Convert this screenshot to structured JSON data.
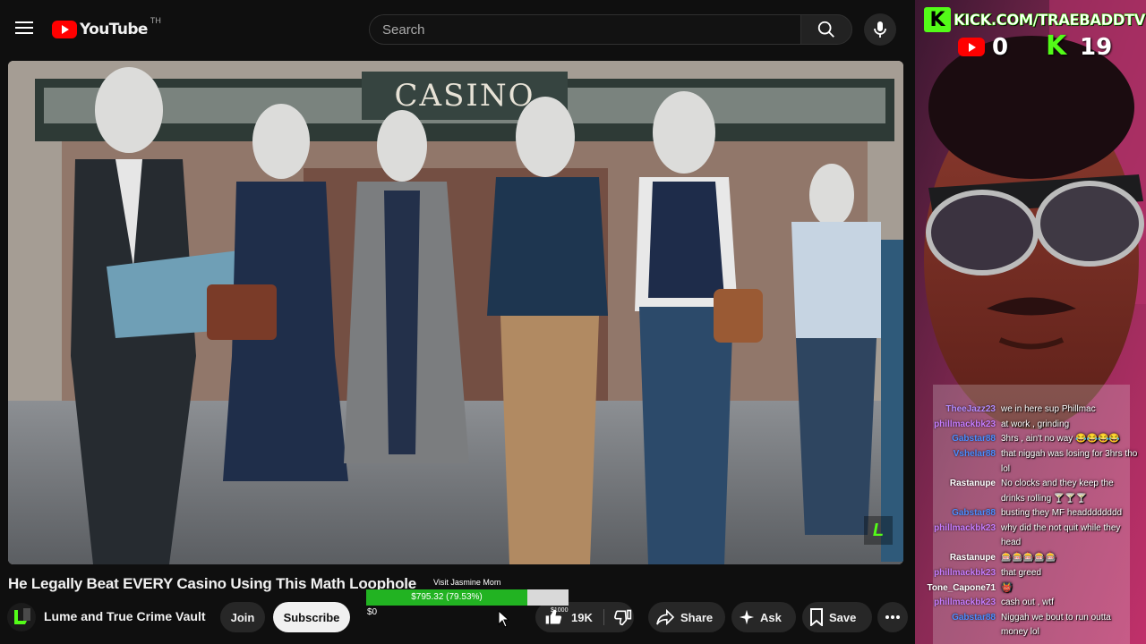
{
  "header": {
    "logo_text": "YouTube",
    "logo_region": "TH",
    "search_placeholder": "Search"
  },
  "video": {
    "thumbnail_sign": "CASINO",
    "watermark": "L",
    "title": "He Legally Beat EVERY Casino Using This Math Loophole",
    "channel_name": "Lume and True Crime Vault",
    "join_label": "Join",
    "subscribe_label": "Subscribe",
    "likes": "19K",
    "share_label": "Share",
    "ask_label": "Ask",
    "save_label": "Save"
  },
  "donation": {
    "label": "Visit Jasmine Mom",
    "amount_text": "$795.32 (79.53%)",
    "progress": 0.7953,
    "min_label": "$0",
    "max_label": "$1000"
  },
  "stream": {
    "kick_url": "KICK.COM/TRAEBADDTV",
    "youtube_viewers": "0",
    "kick_viewers": "19",
    "kick_logo": "K"
  },
  "chat": [
    {
      "user": "TheeJazz23",
      "color": "#b48cff",
      "msg": "we in here sup Phillmac"
    },
    {
      "user": "phillmackbk23",
      "color": "#c77dff",
      "msg": "at work , grinding"
    },
    {
      "user": "Gabstar88",
      "color": "#4d8dff",
      "msg": "3hrs , ain't no way 😂😂😂😂"
    },
    {
      "user": "Vshelar88",
      "color": "#4d8dff",
      "msg": "that niggah was losing for 3hrs tho lol"
    },
    {
      "user": "Rastanupe",
      "color": "#ffffff",
      "msg": "No clocks and they keep the drinks rolling 🍸🍸🍸"
    },
    {
      "user": "Gabstar88",
      "color": "#4d8dff",
      "msg": "busting they MF headddddddd"
    },
    {
      "user": "phillmackbk23",
      "color": "#c77dff",
      "msg": "why did the not quit while they head"
    },
    {
      "user": "Rastanupe",
      "color": "#ffffff",
      "msg": "🎰🎰🎰🎰🎰"
    },
    {
      "user": "phillmackbk23",
      "color": "#c77dff",
      "msg": "that greed"
    },
    {
      "user": "Tone_Capone71",
      "color": "#ffffff",
      "msg": "👹"
    },
    {
      "user": "phillmackbk23",
      "color": "#c77dff",
      "msg": "cash out , wtf"
    },
    {
      "user": "Gabstar88",
      "color": "#4d8dff",
      "msg": "Niggah we bout to run outta money lol"
    }
  ]
}
